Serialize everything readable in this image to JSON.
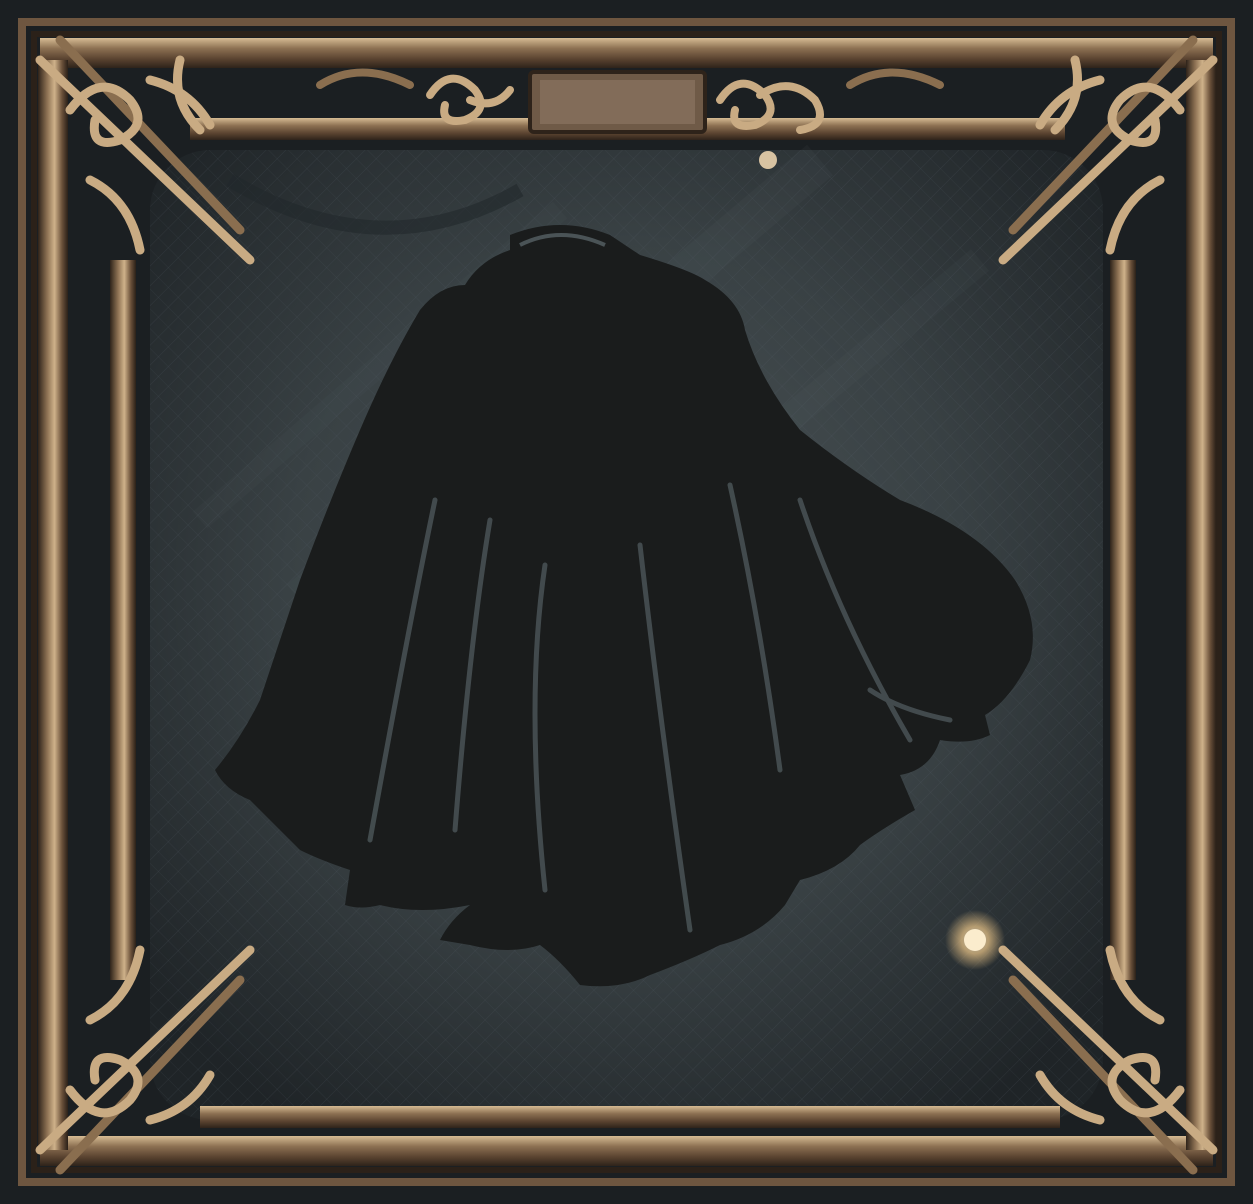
{
  "slot": {
    "kind": "equipment-slot",
    "item_type": "cloak",
    "state": "empty",
    "icon": "cloak-silhouette-icon"
  },
  "frame": {
    "style": "ornate-bronze",
    "icons": [
      "celtic-knot-corner-icon",
      "scroll-ornament-icon",
      "gem-stud-icon"
    ]
  },
  "colors": {
    "background_panel": "#3b4245",
    "background_dark": "#1b1f22",
    "frame_bronze_light": "#c9ab83",
    "frame_bronze_mid": "#8a6e4f",
    "frame_bronze_dark": "#3a2c20",
    "silhouette": "#1a1c1c",
    "glow_stud": "#f6e2c0"
  }
}
